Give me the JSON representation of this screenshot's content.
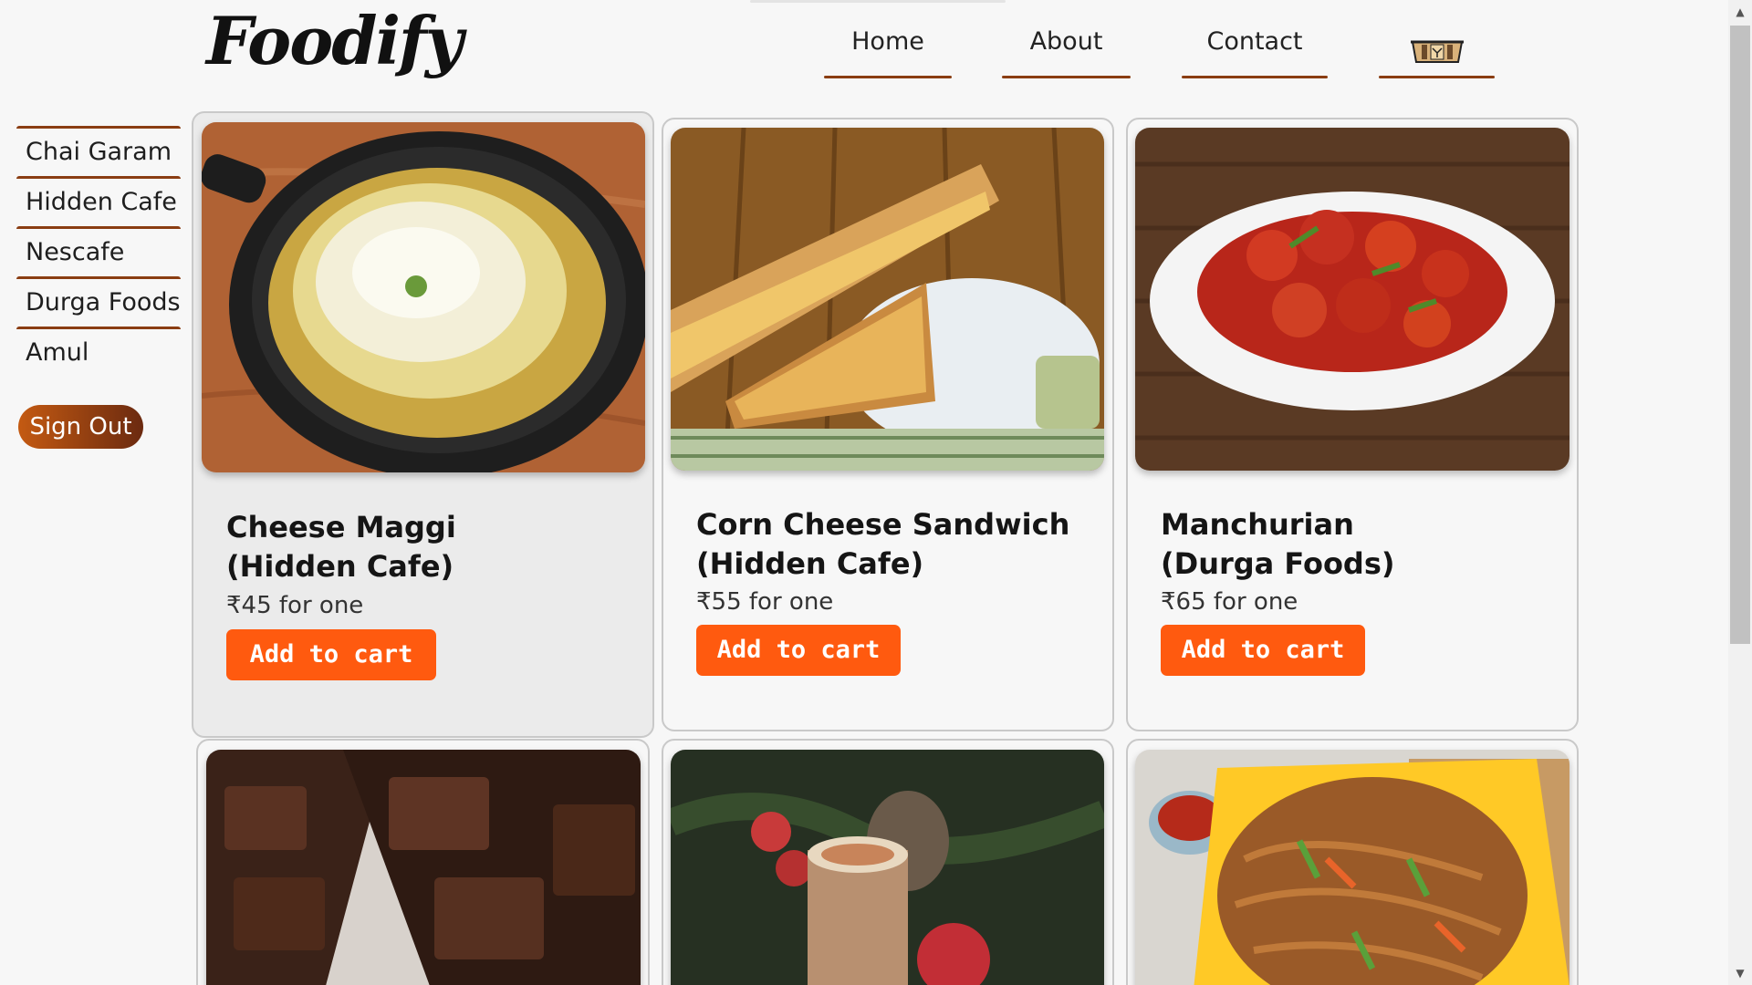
{
  "brand": {
    "logo": "Foodify"
  },
  "nav": {
    "items": [
      {
        "label": "Home"
      },
      {
        "label": "About"
      },
      {
        "label": "Contact"
      }
    ],
    "cart_icon": "cart-icon"
  },
  "sidebar": {
    "items": [
      {
        "label": "Chai Garam"
      },
      {
        "label": "Hidden Cafe"
      },
      {
        "label": "Nescafe"
      },
      {
        "label": "Durga Foods"
      },
      {
        "label": "Amul"
      }
    ],
    "signout_label": "Sign Out"
  },
  "cards": [
    {
      "name_line1": "Cheese Maggi",
      "name_line2": "(Hidden Cafe)",
      "price": "₹45 for one",
      "button": "Add to cart",
      "image": "cheese-maggi-photo"
    },
    {
      "name_line1": "Corn Cheese Sandwich",
      "name_line2": "(Hidden Cafe)",
      "price": "₹55 for one",
      "button": "Add to cart",
      "image": "corn-cheese-sandwich-photo"
    },
    {
      "name_line1": "Manchurian",
      "name_line2": "(Durga Foods)",
      "price": "₹65 for one",
      "button": "Add to cart",
      "image": "manchurian-photo"
    },
    {
      "image": "brownie-photo"
    },
    {
      "image": "cold-coffee-photo"
    },
    {
      "image": "hakka-noodles-photo"
    }
  ],
  "colors": {
    "accent": "#ff5a0f",
    "nav_underline": "#8a3d12",
    "signout_start": "#c45a12",
    "signout_end": "#6b2a10",
    "background": "#f7f7f7"
  }
}
